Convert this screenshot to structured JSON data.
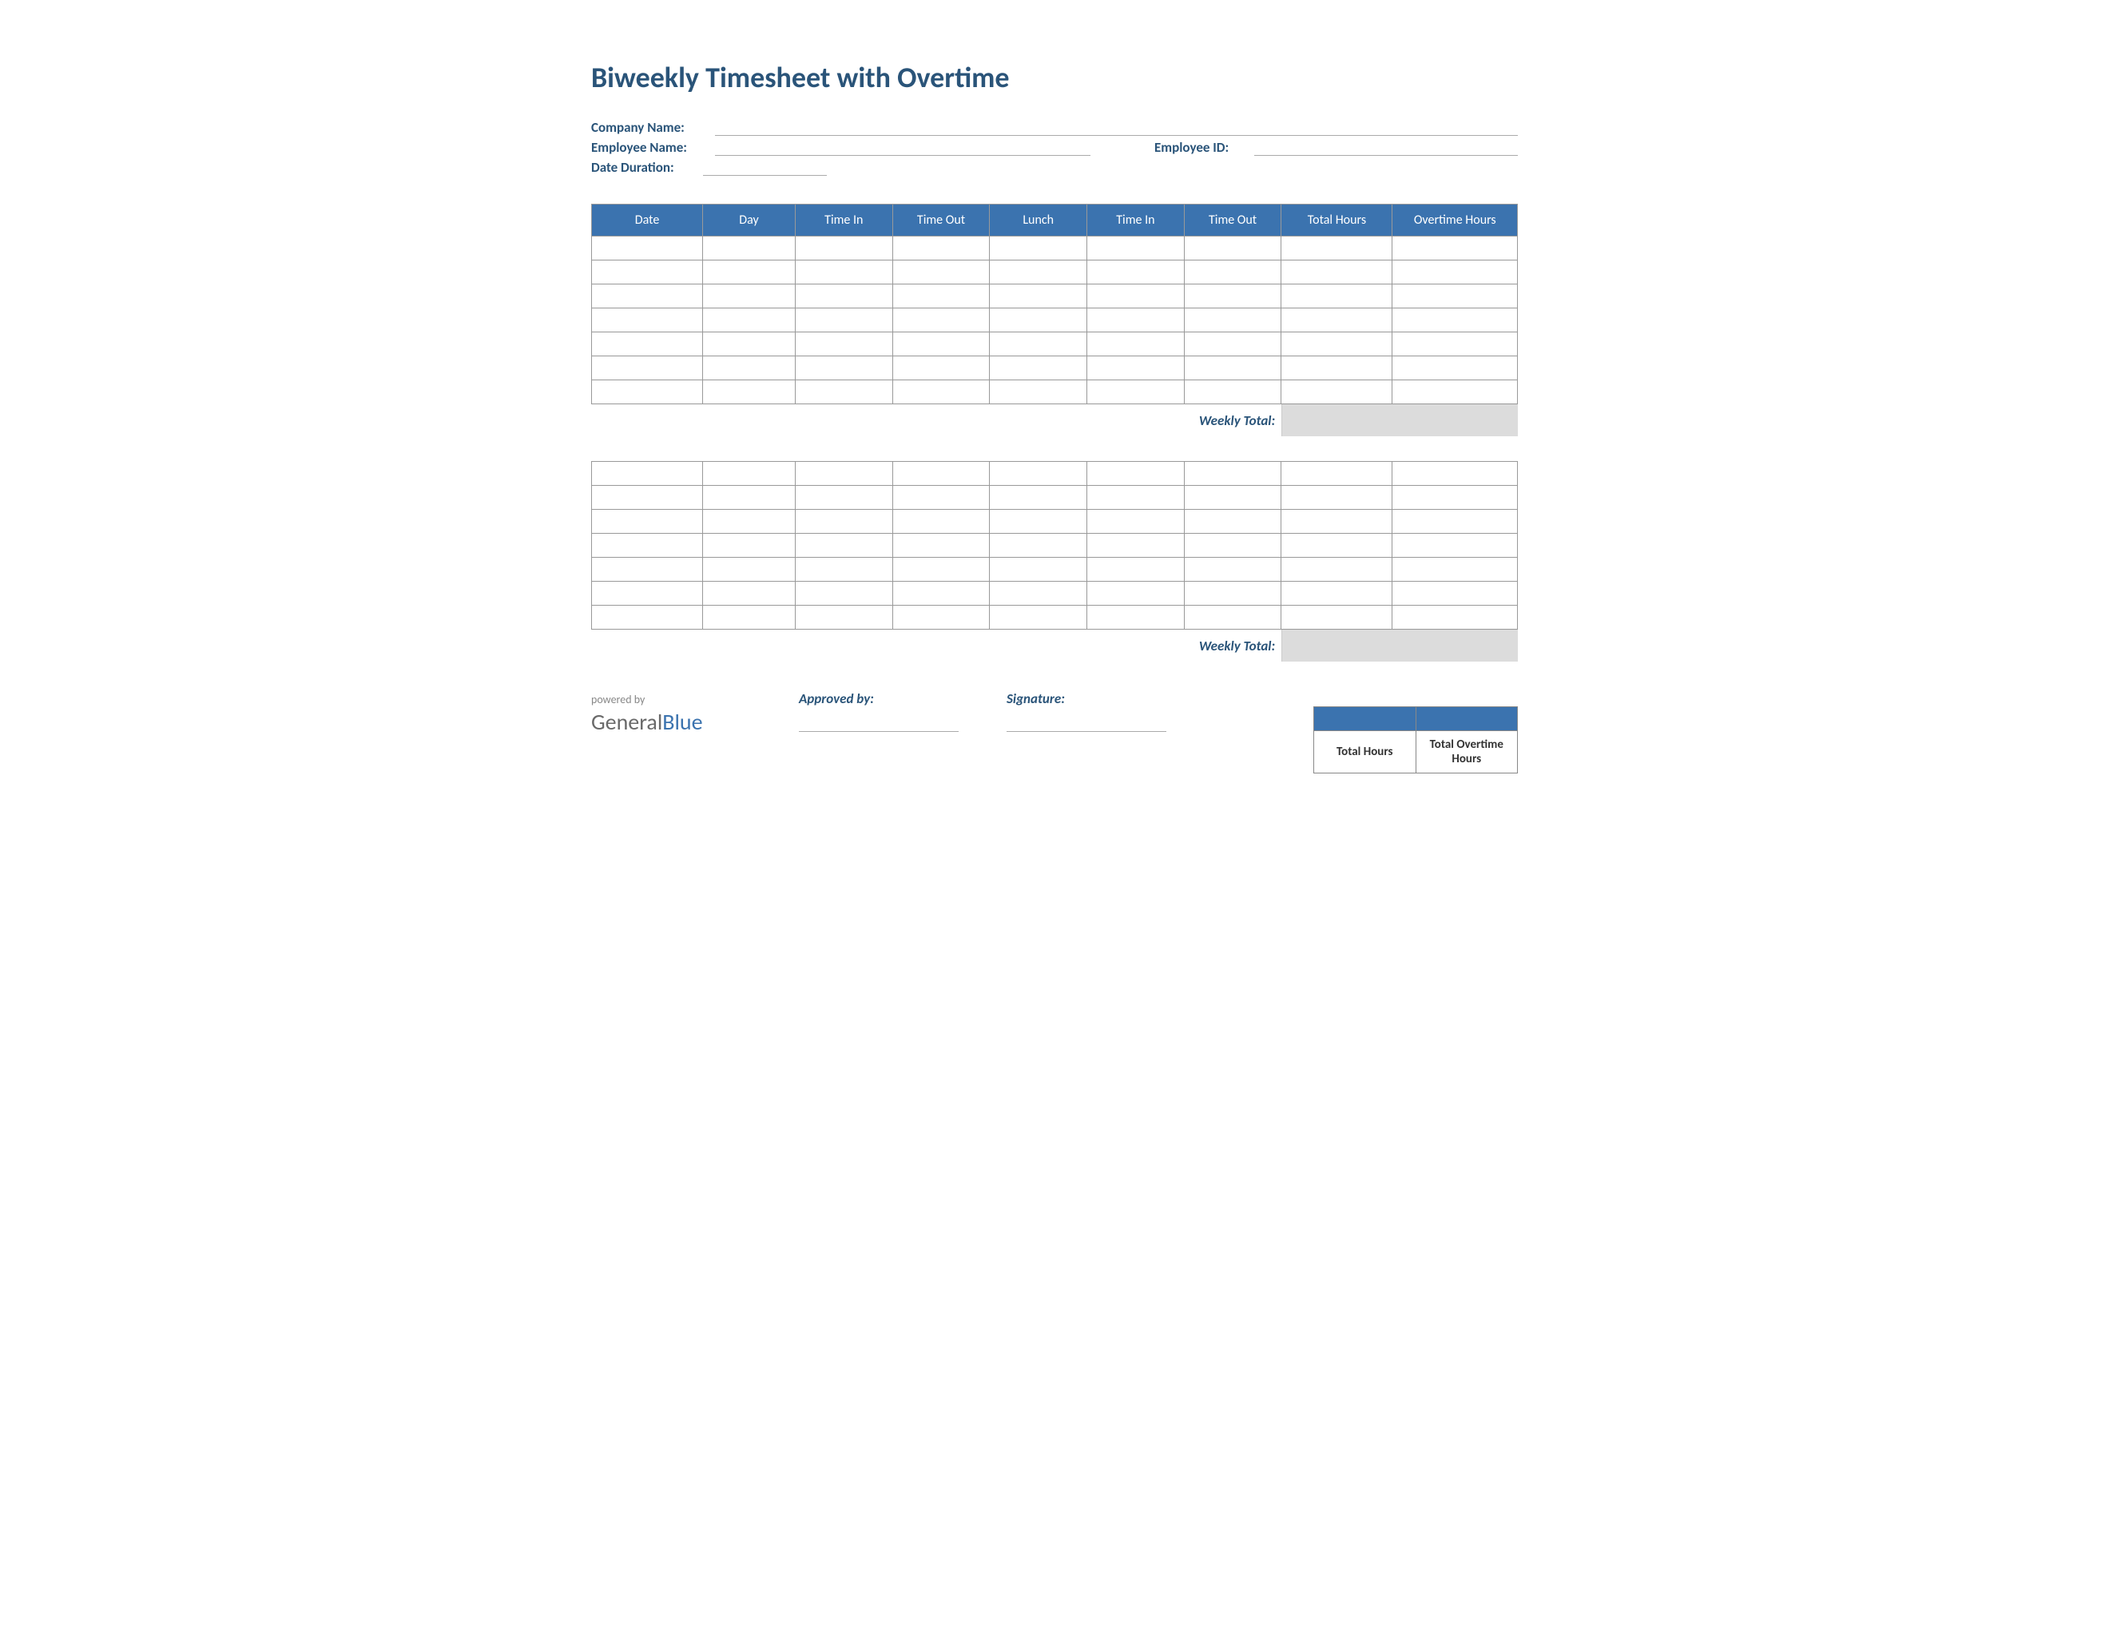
{
  "title": "Biweekly Timesheet with Overtime",
  "info": {
    "company_label": "Company Name:",
    "employee_label": "Employee Name:",
    "employee_id_label": "Employee ID:",
    "date_duration_label": "Date Duration:"
  },
  "headers": [
    "Date",
    "Day",
    "Time In",
    "Time Out",
    "Lunch",
    "Time In",
    "Time Out",
    "Total Hours",
    "Overtime Hours"
  ],
  "weekly_total_label": "Weekly Total:",
  "week1_rows": 7,
  "week2_rows": 7,
  "footer": {
    "powered_by": "powered by",
    "brand_general": "General",
    "brand_blue": "Blue",
    "approved_by": "Approved by:",
    "signature": "Signature:"
  },
  "summary": {
    "total_hours": "Total Hours",
    "total_overtime": "Total Overtime Hours"
  }
}
